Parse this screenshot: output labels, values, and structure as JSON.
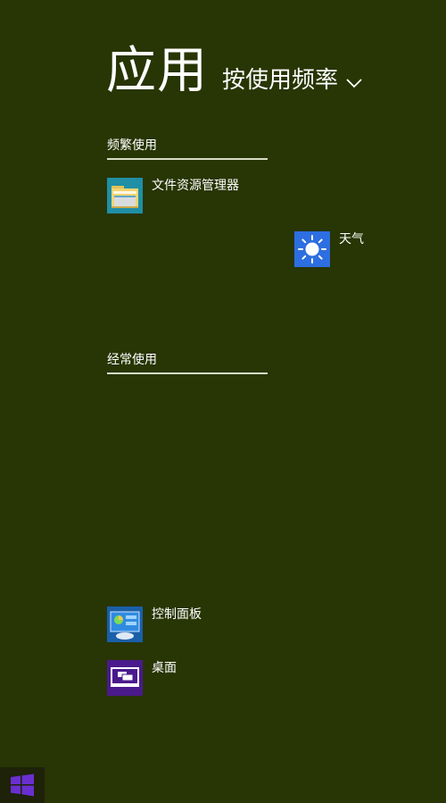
{
  "header": {
    "title": "应用",
    "sort_label": "按使用频率"
  },
  "groups": [
    {
      "label": "频繁使用",
      "apps": [
        {
          "label": "文件资源管理器",
          "icon": "file-explorer-icon"
        },
        {
          "label": "天气",
          "icon": "weather-icon"
        }
      ]
    },
    {
      "label": "经常使用",
      "apps": [
        {
          "label": "控制面板",
          "icon": "control-panel-icon"
        },
        {
          "label": "桌面",
          "icon": "desktop-icon"
        }
      ]
    }
  ],
  "colors": {
    "background": "#283504",
    "weather_tile": "#2d6ee0",
    "desktop_tile": "#4a1a8c",
    "control_panel_tile": "#1a5fa8",
    "start_logo": "#6a2fd0"
  },
  "start_button": {
    "icon": "windows-logo-icon"
  }
}
